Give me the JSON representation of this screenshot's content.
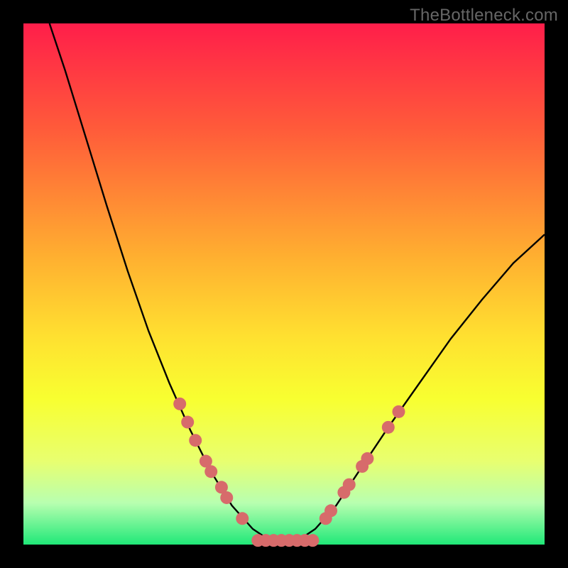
{
  "brand": "TheBottleneck.com",
  "chart_data": {
    "type": "line",
    "title": "",
    "xlabel": "",
    "ylabel": "",
    "xlim": [
      0,
      100
    ],
    "ylim": [
      0,
      100
    ],
    "gradient_stops": [
      {
        "offset": 0,
        "color": "#ff1e4a"
      },
      {
        "offset": 20,
        "color": "#ff5a3a"
      },
      {
        "offset": 45,
        "color": "#ffb030"
      },
      {
        "offset": 60,
        "color": "#ffe030"
      },
      {
        "offset": 72,
        "color": "#f8ff30"
      },
      {
        "offset": 84,
        "color": "#e8ff70"
      },
      {
        "offset": 92,
        "color": "#b8ffb0"
      },
      {
        "offset": 100,
        "color": "#20e878"
      }
    ],
    "series": [
      {
        "name": "bottleneck-curve",
        "type": "line",
        "color": "#000000",
        "points": [
          {
            "x": 5.0,
            "y": 100.0
          },
          {
            "x": 8.0,
            "y": 91.0
          },
          {
            "x": 12.0,
            "y": 78.0
          },
          {
            "x": 16.0,
            "y": 65.0
          },
          {
            "x": 20.0,
            "y": 52.5
          },
          {
            "x": 24.0,
            "y": 41.0
          },
          {
            "x": 28.0,
            "y": 31.0
          },
          {
            "x": 32.0,
            "y": 22.0
          },
          {
            "x": 36.0,
            "y": 14.0
          },
          {
            "x": 40.0,
            "y": 7.5
          },
          {
            "x": 44.0,
            "y": 3.0
          },
          {
            "x": 47.0,
            "y": 1.0
          },
          {
            "x": 50.0,
            "y": 0.5
          },
          {
            "x": 53.0,
            "y": 1.0
          },
          {
            "x": 56.0,
            "y": 3.0
          },
          {
            "x": 60.0,
            "y": 7.5
          },
          {
            "x": 65.0,
            "y": 15.0
          },
          {
            "x": 70.0,
            "y": 22.5
          },
          {
            "x": 76.0,
            "y": 31.0
          },
          {
            "x": 82.0,
            "y": 39.5
          },
          {
            "x": 88.0,
            "y": 47.0
          },
          {
            "x": 94.0,
            "y": 54.0
          },
          {
            "x": 100.0,
            "y": 59.5
          }
        ]
      },
      {
        "name": "markers-left",
        "type": "scatter",
        "color": "#d76b6b",
        "points": [
          {
            "x": 30.0,
            "y": 27.0
          },
          {
            "x": 31.5,
            "y": 23.5
          },
          {
            "x": 33.0,
            "y": 20.0
          },
          {
            "x": 35.0,
            "y": 16.0
          },
          {
            "x": 36.0,
            "y": 14.0
          },
          {
            "x": 38.0,
            "y": 11.0
          },
          {
            "x": 39.0,
            "y": 9.0
          },
          {
            "x": 42.0,
            "y": 5.0
          }
        ]
      },
      {
        "name": "markers-right",
        "type": "scatter",
        "color": "#d76b6b",
        "points": [
          {
            "x": 58.0,
            "y": 5.0
          },
          {
            "x": 59.0,
            "y": 6.5
          },
          {
            "x": 61.5,
            "y": 10.0
          },
          {
            "x": 62.5,
            "y": 11.5
          },
          {
            "x": 65.0,
            "y": 15.0
          },
          {
            "x": 66.0,
            "y": 16.5
          },
          {
            "x": 70.0,
            "y": 22.5
          },
          {
            "x": 72.0,
            "y": 25.5
          }
        ]
      },
      {
        "name": "baseline-pills",
        "type": "scatter",
        "color": "#d76b6b",
        "points": [
          {
            "x": 45.0,
            "y": 0.8
          },
          {
            "x": 46.5,
            "y": 0.8
          },
          {
            "x": 48.0,
            "y": 0.8
          },
          {
            "x": 49.5,
            "y": 0.8
          },
          {
            "x": 51.0,
            "y": 0.8
          },
          {
            "x": 52.5,
            "y": 0.8
          },
          {
            "x": 54.0,
            "y": 0.8
          },
          {
            "x": 55.5,
            "y": 0.8
          }
        ]
      }
    ]
  }
}
